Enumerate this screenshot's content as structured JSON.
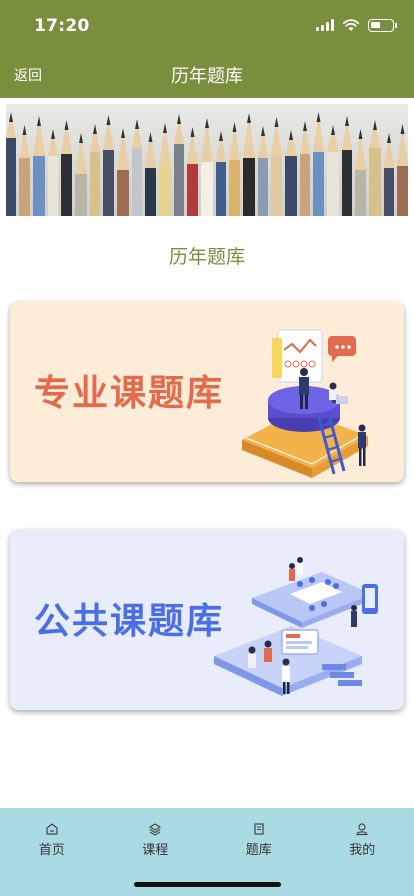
{
  "status_bar": {
    "time": "17:20",
    "battery_level": 0.45
  },
  "nav": {
    "back_label": "返回",
    "title": "历年题库"
  },
  "section_title": "历年题库",
  "cards": [
    {
      "label": "专业课题库",
      "accent": "#e36a4c",
      "background": "#fcecd8"
    },
    {
      "label": "公共课题库",
      "accent": "#4a6ee8",
      "background": "#e8ecfb"
    }
  ],
  "tabbar": {
    "items": [
      {
        "label": "首页",
        "icon": "home-icon"
      },
      {
        "label": "课程",
        "icon": "layers-icon"
      },
      {
        "label": "题库",
        "icon": "book-icon"
      },
      {
        "label": "我的",
        "icon": "user-icon"
      }
    ]
  },
  "colors": {
    "header": "#7a8f3e",
    "tabbar": "#aadbe2"
  }
}
